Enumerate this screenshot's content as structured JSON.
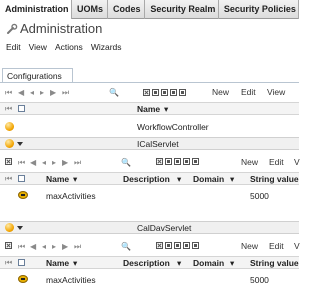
{
  "tabs": [
    {
      "label": "Administration",
      "active": true
    },
    {
      "label": "UOMs",
      "active": false
    },
    {
      "label": "Codes",
      "active": false
    },
    {
      "label": "Security Realm",
      "active": false
    },
    {
      "label": "Security Policies",
      "active": false
    }
  ],
  "header": {
    "title": "Administration",
    "icon": "wrench-icon"
  },
  "menubar": [
    "Edit",
    "View",
    "Actions",
    "Wizards"
  ],
  "panel_tab": "Configurations",
  "toolbar": {
    "new": "New",
    "edit": "Edit",
    "view": "View"
  },
  "main_table": {
    "column": "Name",
    "sort": "▾",
    "rows": [
      "WorkflowController"
    ]
  },
  "groups": [
    {
      "name": "ICalServlet",
      "toolbar": {
        "new": "New",
        "edit": "Edit",
        "view": "V"
      },
      "columns": [
        "Name",
        "Description",
        "Domain",
        "String value"
      ],
      "rows": [
        {
          "name": "maxActivities",
          "description": "",
          "domain": "",
          "value": "5000"
        }
      ]
    },
    {
      "name": "CalDavServlet",
      "toolbar": {
        "new": "New",
        "edit": "Edit",
        "view": "V"
      },
      "columns": [
        "Name",
        "Description",
        "Domain",
        "String value"
      ],
      "rows": [
        {
          "name": "maxActivities",
          "description": "",
          "domain": "",
          "value": "5000"
        }
      ]
    }
  ],
  "colors": {
    "accent_border": "#b9c5d1",
    "group_bg": "#f0f0f0"
  }
}
